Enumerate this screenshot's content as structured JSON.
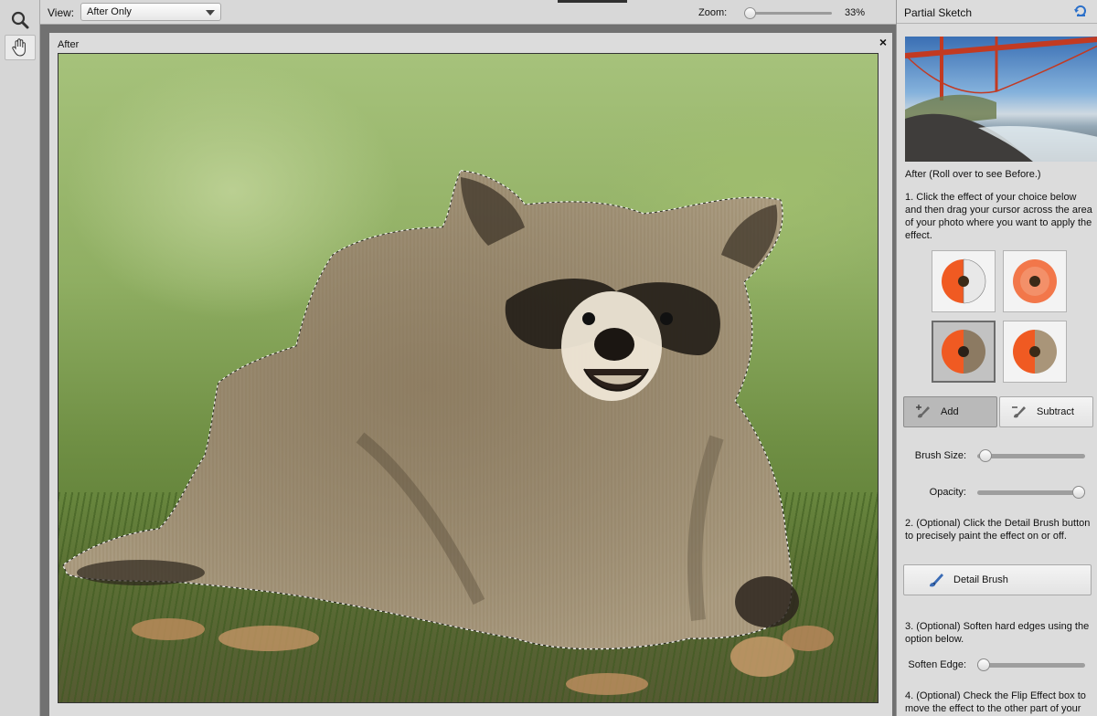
{
  "toolbar": {
    "tools": [
      {
        "icon": "magnifier-icon"
      },
      {
        "icon": "hand-icon"
      }
    ]
  },
  "options_bar": {
    "view_label": "View:",
    "view_selected": "After Only",
    "zoom_label": "Zoom:",
    "zoom_value": "33%",
    "zoom_fraction": 0
  },
  "document": {
    "title": "After",
    "close_glyph": "×"
  },
  "panel": {
    "title": "Partial Sketch",
    "preview_caption": "After (Roll over to see Before.)",
    "step1": "1. Click the effect of your choice below and then drag your cursor across the area of your photo where you want to apply the effect.",
    "effects": [
      {
        "name": "effect-1",
        "selected": false
      },
      {
        "name": "effect-2",
        "selected": false
      },
      {
        "name": "effect-3",
        "selected": true
      },
      {
        "name": "effect-4",
        "selected": false
      }
    ],
    "add_label": "Add",
    "subtract_label": "Subtract",
    "brush_size_label": "Brush Size:",
    "brush_size_value": 0.02,
    "opacity_label": "Opacity:",
    "opacity_value": 1.0,
    "step2": "2. (Optional) Click the Detail Brush button to precisely paint the effect on or off.",
    "detail_brush_label": "Detail Brush",
    "step3": "3. (Optional) Soften hard edges using the option below.",
    "soften_edge_label": "Soften Edge:",
    "soften_edge_value": 0.0,
    "step4": "4. (Optional) Check the Flip Effect box to move the effect to the other part of your"
  },
  "colors": {
    "panel_bg": "#dcdcdc",
    "canvas_bg": "#717171",
    "accent_blue": "#2a6fc9"
  }
}
